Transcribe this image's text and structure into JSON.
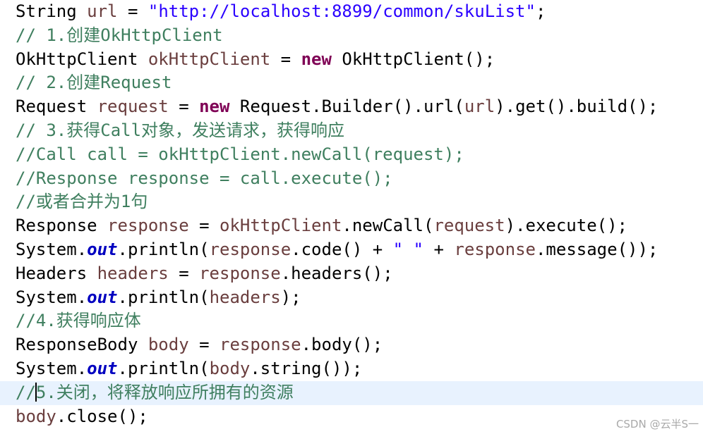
{
  "editor": {
    "current_line_index": 16,
    "colors": {
      "plain": "#000000",
      "variable": "#6a3e3e",
      "string": "#2a00ff",
      "comment": "#3f7f5f",
      "keyword": "#7f0055",
      "field": "#0000c0",
      "current_line_background": "#e8f2fe"
    },
    "lines": [
      [
        {
          "k": "plain",
          "t": "String "
        },
        {
          "k": "var",
          "t": "url"
        },
        {
          "k": "plain",
          "t": " = "
        },
        {
          "k": "string",
          "t": "\"http://localhost:8899/common/skuList\""
        },
        {
          "k": "plain",
          "t": ";"
        }
      ],
      [
        {
          "k": "comment",
          "t": "// 1.创建OkHttpClient"
        }
      ],
      [
        {
          "k": "plain",
          "t": "OkHttpClient "
        },
        {
          "k": "var",
          "t": "okHttpClient"
        },
        {
          "k": "plain",
          "t": " = "
        },
        {
          "k": "keyword",
          "t": "new"
        },
        {
          "k": "plain",
          "t": " OkHttpClient();"
        }
      ],
      [
        {
          "k": "comment",
          "t": "// 2.创建Request"
        }
      ],
      [
        {
          "k": "plain",
          "t": "Request "
        },
        {
          "k": "var",
          "t": "request"
        },
        {
          "k": "plain",
          "t": " = "
        },
        {
          "k": "keyword",
          "t": "new"
        },
        {
          "k": "plain",
          "t": " Request.Builder().url("
        },
        {
          "k": "var",
          "t": "url"
        },
        {
          "k": "plain",
          "t": ").get().build();"
        }
      ],
      [
        {
          "k": "comment",
          "t": "// 3.获得Call对象，发送请求，获得响应"
        }
      ],
      [
        {
          "k": "comment",
          "t": "//Call call = okHttpClient.newCall(request);"
        }
      ],
      [
        {
          "k": "comment",
          "t": "//Response response = call.execute();"
        }
      ],
      [
        {
          "k": "comment",
          "t": "//或者合并为1句"
        }
      ],
      [
        {
          "k": "plain",
          "t": "Response "
        },
        {
          "k": "var",
          "t": "response"
        },
        {
          "k": "plain",
          "t": " = "
        },
        {
          "k": "var",
          "t": "okHttpClient"
        },
        {
          "k": "plain",
          "t": ".newCall("
        },
        {
          "k": "var",
          "t": "request"
        },
        {
          "k": "plain",
          "t": ").execute();"
        }
      ],
      [
        {
          "k": "plain",
          "t": "System."
        },
        {
          "k": "field",
          "t": "out"
        },
        {
          "k": "plain",
          "t": ".println("
        },
        {
          "k": "var",
          "t": "response"
        },
        {
          "k": "plain",
          "t": ".code() + "
        },
        {
          "k": "string",
          "t": "\" \""
        },
        {
          "k": "plain",
          "t": " + "
        },
        {
          "k": "var",
          "t": "response"
        },
        {
          "k": "plain",
          "t": ".message());"
        }
      ],
      [
        {
          "k": "plain",
          "t": "Headers "
        },
        {
          "k": "var",
          "t": "headers"
        },
        {
          "k": "plain",
          "t": " = "
        },
        {
          "k": "var",
          "t": "response"
        },
        {
          "k": "plain",
          "t": ".headers();"
        }
      ],
      [
        {
          "k": "plain",
          "t": "System."
        },
        {
          "k": "field",
          "t": "out"
        },
        {
          "k": "plain",
          "t": ".println("
        },
        {
          "k": "var",
          "t": "headers"
        },
        {
          "k": "plain",
          "t": ");"
        }
      ],
      [
        {
          "k": "comment",
          "t": "//4.获得响应体"
        }
      ],
      [
        {
          "k": "plain",
          "t": "ResponseBody "
        },
        {
          "k": "var",
          "t": "body"
        },
        {
          "k": "plain",
          "t": " = "
        },
        {
          "k": "var",
          "t": "response"
        },
        {
          "k": "plain",
          "t": ".body();"
        }
      ],
      [
        {
          "k": "plain",
          "t": "System."
        },
        {
          "k": "field",
          "t": "out"
        },
        {
          "k": "plain",
          "t": ".println("
        },
        {
          "k": "var",
          "t": "body"
        },
        {
          "k": "plain",
          "t": ".string());"
        }
      ],
      [
        {
          "k": "comment",
          "t": "//5.关闭，将释放响应所拥有的资源"
        }
      ],
      [
        {
          "k": "var",
          "t": "body"
        },
        {
          "k": "plain",
          "t": ".close();"
        }
      ]
    ]
  },
  "watermark": {
    "text": "CSDN @云半S一"
  }
}
